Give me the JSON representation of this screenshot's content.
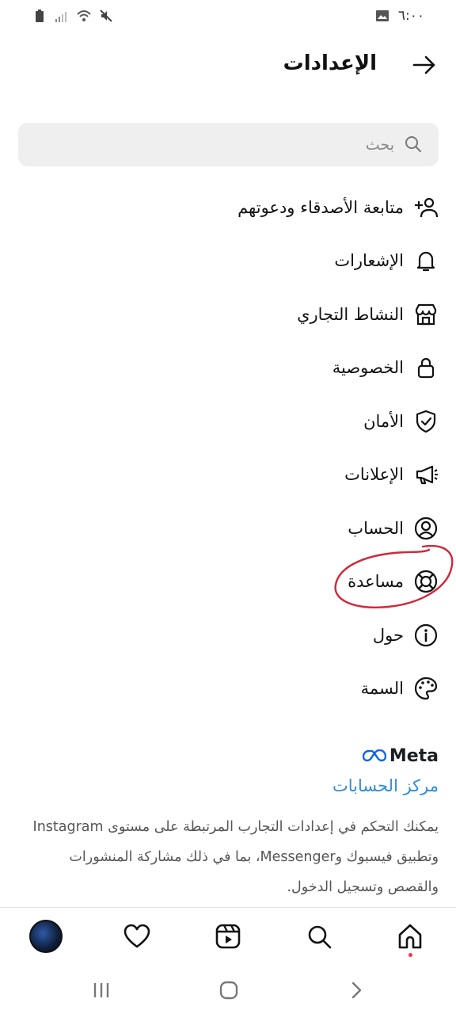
{
  "status_bar": {
    "time": "٦:٠٠",
    "icons": [
      "battery-icon",
      "signal-icon",
      "wifi-icon",
      "mute-icon",
      "gallery-notification-icon"
    ]
  },
  "header": {
    "title": "الإعدادات",
    "back_icon": "arrow-right-icon"
  },
  "search": {
    "placeholder": "بحث",
    "value": ""
  },
  "menu": [
    {
      "label": "متابعة الأصدقاء ودعوتهم",
      "icon": "add-person-icon"
    },
    {
      "label": "الإشعارات",
      "icon": "bell-icon"
    },
    {
      "label": "النشاط التجاري",
      "icon": "shop-icon"
    },
    {
      "label": "الخصوصية",
      "icon": "lock-icon"
    },
    {
      "label": "الأمان",
      "icon": "shield-check-icon"
    },
    {
      "label": "الإعلانات",
      "icon": "megaphone-icon"
    },
    {
      "label": "الحساب",
      "icon": "account-circle-icon"
    },
    {
      "label": "مساعدة",
      "icon": "lifebuoy-icon"
    },
    {
      "label": "حول",
      "icon": "info-icon"
    },
    {
      "label": "السمة",
      "icon": "palette-icon"
    }
  ],
  "meta": {
    "logo_text": "Meta",
    "accounts_center": "مركز الحسابات",
    "description": "يمكنك التحكم في إعدادات التجارب المرتبطة على مستوى Instagram وتطبيق فيسبوك وMessenger، بما في ذلك مشاركة المنشورات والقصص وتسجيل الدخول."
  },
  "bottom_nav": [
    "home-icon",
    "search-icon",
    "reels-icon",
    "heart-icon",
    "profile-avatar"
  ],
  "colors": {
    "link": "#2f8fd8",
    "annotation_circle": "#d0283a",
    "notification_dot": "#ff3040",
    "search_bg": "#efefef"
  }
}
